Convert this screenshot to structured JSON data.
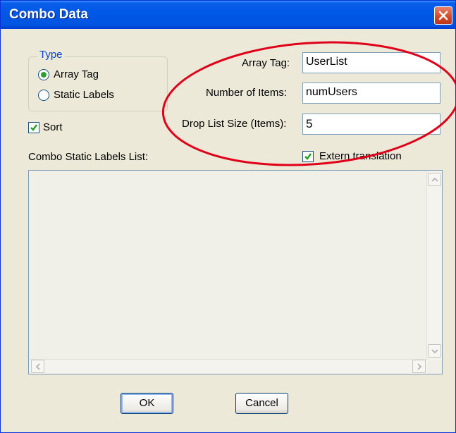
{
  "window": {
    "title": "Combo Data"
  },
  "type_group": {
    "legend": "Type",
    "options": [
      "Array Tag",
      "Static Labels"
    ],
    "selected": "Array Tag"
  },
  "sort": {
    "label": "Sort",
    "checked": true
  },
  "fields": {
    "array_tag": {
      "label": "Array Tag:",
      "value": "UserList"
    },
    "number_of_items": {
      "label": "Number of Items:",
      "value": "numUsers"
    },
    "drop_list_size": {
      "label": "Drop List Size (Items):",
      "value": "5"
    }
  },
  "static_list": {
    "label": "Combo Static Labels List:",
    "items": []
  },
  "extern_translation": {
    "label": "Extern translation",
    "checked": true
  },
  "buttons": {
    "ok": "OK",
    "cancel": "Cancel"
  },
  "colors": {
    "annotation": "#e0001a",
    "titlebar": "#0058e6",
    "dialog_bg": "#ece9d8"
  }
}
